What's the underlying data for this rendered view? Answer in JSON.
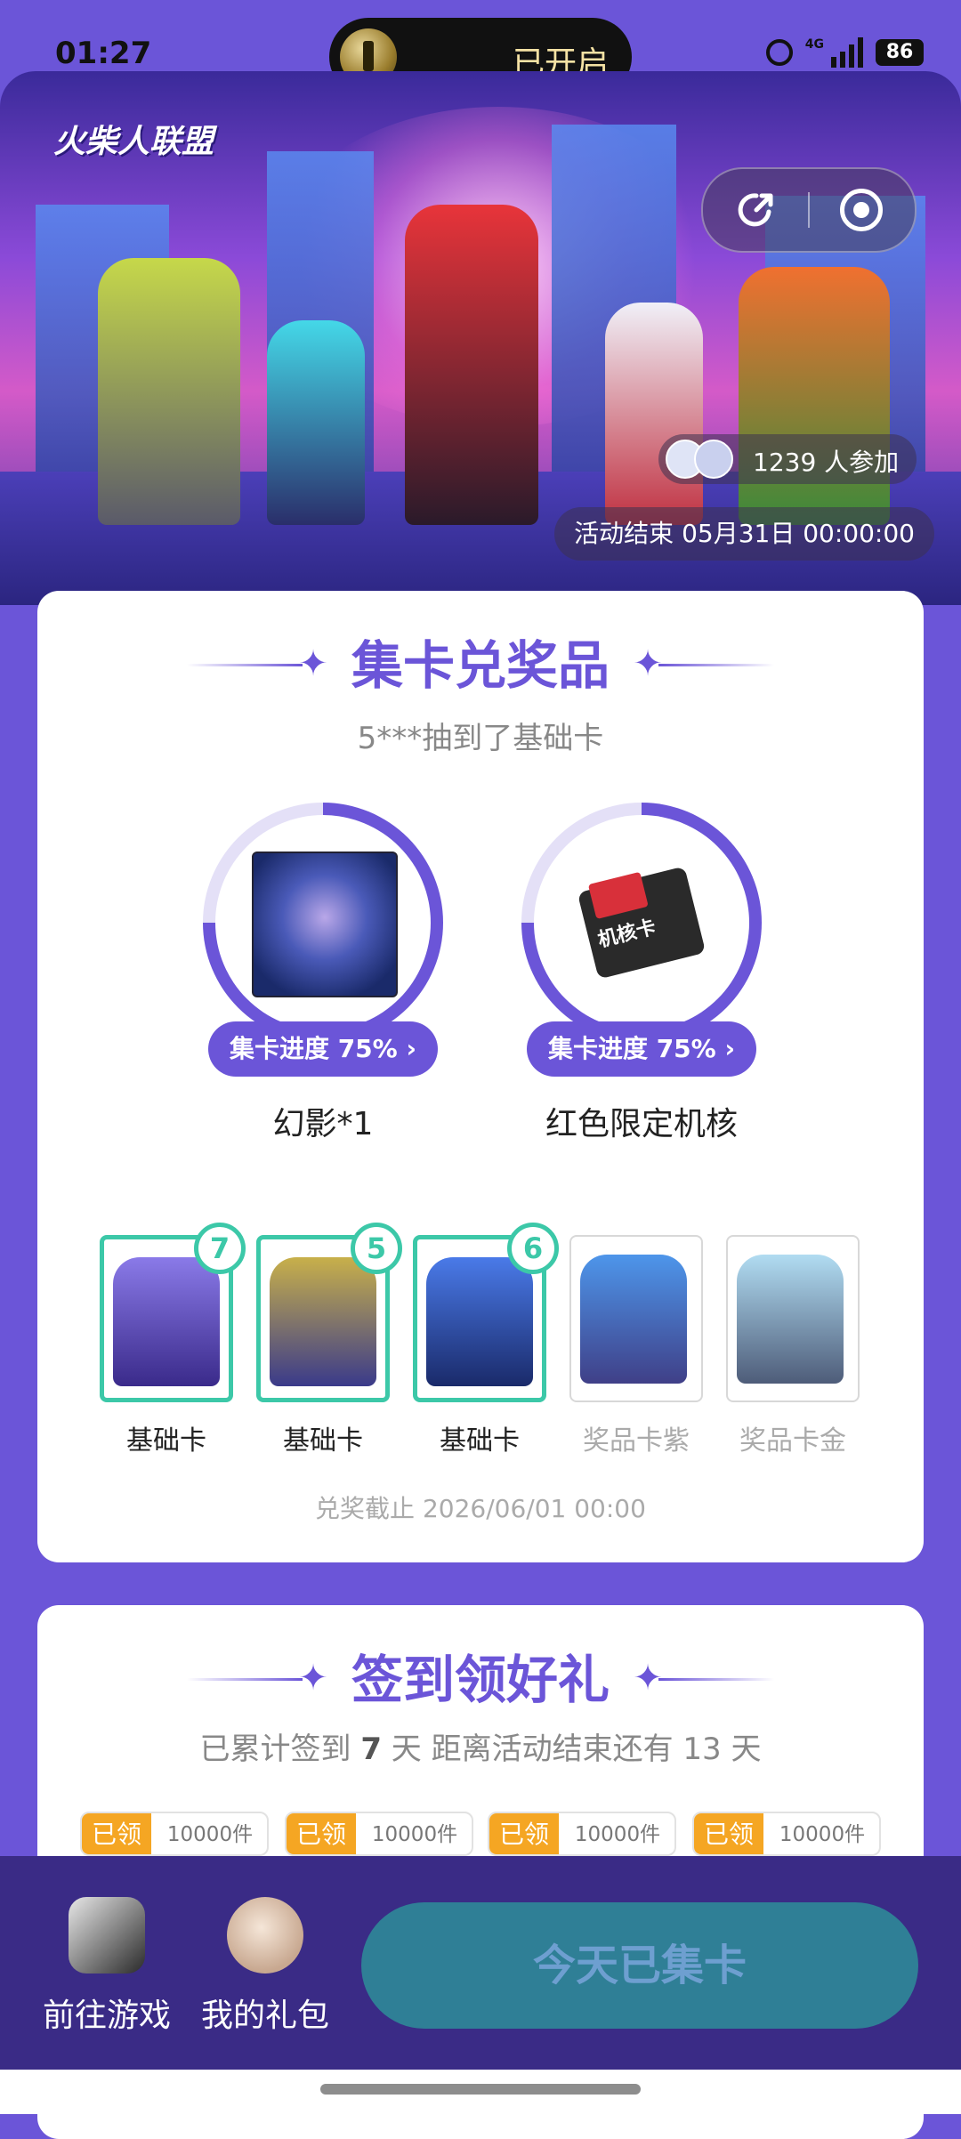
{
  "status_bar": {
    "time": "01:27",
    "pill_text": "已开启",
    "network": "4G",
    "battery": "86"
  },
  "hero": {
    "logo_text": "火柴人联盟",
    "participants": "1239 人参加",
    "end_time": "活动结束 05月31日 00:00:00"
  },
  "collect_section": {
    "title": "集卡兑奖品",
    "subtitle": "5***抽到了基础卡",
    "prizes": [
      {
        "progress_label": "集卡进度 75%",
        "name": "幻影*1",
        "progress": 0.75
      },
      {
        "progress_label": "集卡进度 75%",
        "name": "红色限定机核",
        "progress": 0.75
      }
    ],
    "prize_card_text": "机核卡",
    "cards": [
      {
        "label": "基础卡",
        "count": "7",
        "owned": true
      },
      {
        "label": "基础卡",
        "count": "5",
        "owned": true
      },
      {
        "label": "基础卡",
        "count": "6",
        "owned": true
      },
      {
        "label": "奖品卡紫",
        "count": "",
        "owned": false
      },
      {
        "label": "奖品卡金",
        "count": "",
        "owned": false
      }
    ],
    "deadline": "兑奖截止 2026/06/01 00:00"
  },
  "signin_section": {
    "title": "签到领好礼",
    "summary_prefix": "已累计签到",
    "days": "7",
    "summary_mid": "天  距离活动结束还有 13 天",
    "rewards": [
      {
        "status": "已领",
        "qty": "10000件"
      },
      {
        "status": "已领",
        "qty": "10000件"
      },
      {
        "status": "已领",
        "qty": "10000件"
      },
      {
        "status": "已领",
        "qty": "10000件"
      }
    ]
  },
  "bottom_bar": {
    "go_game_label": "前往游戏",
    "gift_label": "我的礼包",
    "cta_label": "今天已集卡"
  },
  "colors": {
    "primary": "#6B55D8",
    "teal": "#3CC8A8",
    "orange": "#F5A623",
    "bottom_bar": "#3A2B86",
    "cta": "#2F7F96"
  }
}
